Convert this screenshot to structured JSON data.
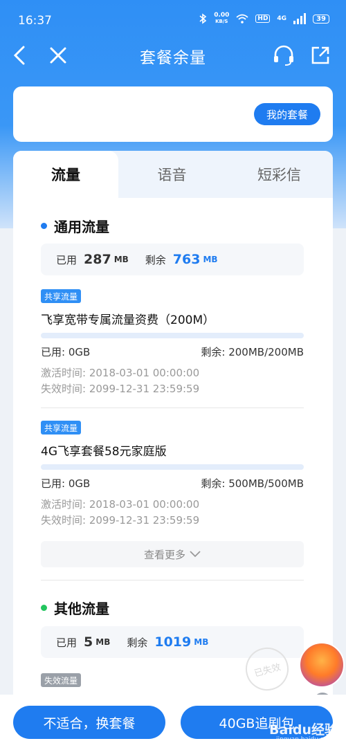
{
  "status_bar": {
    "time": "16:37",
    "net_speed_value": "0.00",
    "net_speed_unit": "KB/S",
    "hd_label": "HD",
    "signal_label": "4G",
    "battery": "39"
  },
  "nav": {
    "title": "套餐余量",
    "back_icon": "back-arrow-icon",
    "close_icon": "close-icon",
    "service_icon": "headset-icon",
    "share_icon": "share-icon"
  },
  "package_card": {
    "my_package_label": "我的套餐"
  },
  "tabs": [
    {
      "label": "流量",
      "active": true
    },
    {
      "label": "语音",
      "active": false
    },
    {
      "label": "短彩信",
      "active": false
    }
  ],
  "general": {
    "title": "通用流量",
    "used_label": "已用",
    "used_value": "287",
    "used_unit": "MB",
    "remain_label": "剩余",
    "remain_value": "763",
    "remain_unit": "MB",
    "items": [
      {
        "badge": "共享流量",
        "name": "飞享宽带专属流量资费（200M）",
        "used": "已用: 0GB",
        "remain": "剩余: 200MB/200MB",
        "usage_fraction": 0,
        "activate": "激活时间: 2018-03-01 00:00:00",
        "expire": "失效时间: 2099-12-31 23:59:59"
      },
      {
        "badge": "共享流量",
        "name": "4G飞享套餐58元家庭版",
        "used": "已用: 0GB",
        "remain": "剩余: 500MB/500MB",
        "usage_fraction": 0,
        "activate": "激活时间: 2018-03-01 00:00:00",
        "expire": "失效时间: 2099-12-31 23:59:59"
      }
    ],
    "more_label": "查看更多"
  },
  "other": {
    "title": "其他流量",
    "used_label": "已用",
    "used_value": "5",
    "used_unit": "MB",
    "remain_label": "剩余",
    "remain_value": "1019",
    "remain_unit": "MB",
    "expired_badge": "失效流量",
    "expired_stamp": "已失效"
  },
  "bottom": {
    "change_plan": "不适合，换套餐",
    "addon": "40GB追剧包"
  },
  "watermark": {
    "brand": "Baidu经验",
    "url": "jingyan.baidu.com"
  },
  "colors": {
    "primary": "#1f7cf0",
    "header_blue": "#2f8ff5",
    "general_dot": "#1f7cf0",
    "other_dot": "#22c55e"
  }
}
